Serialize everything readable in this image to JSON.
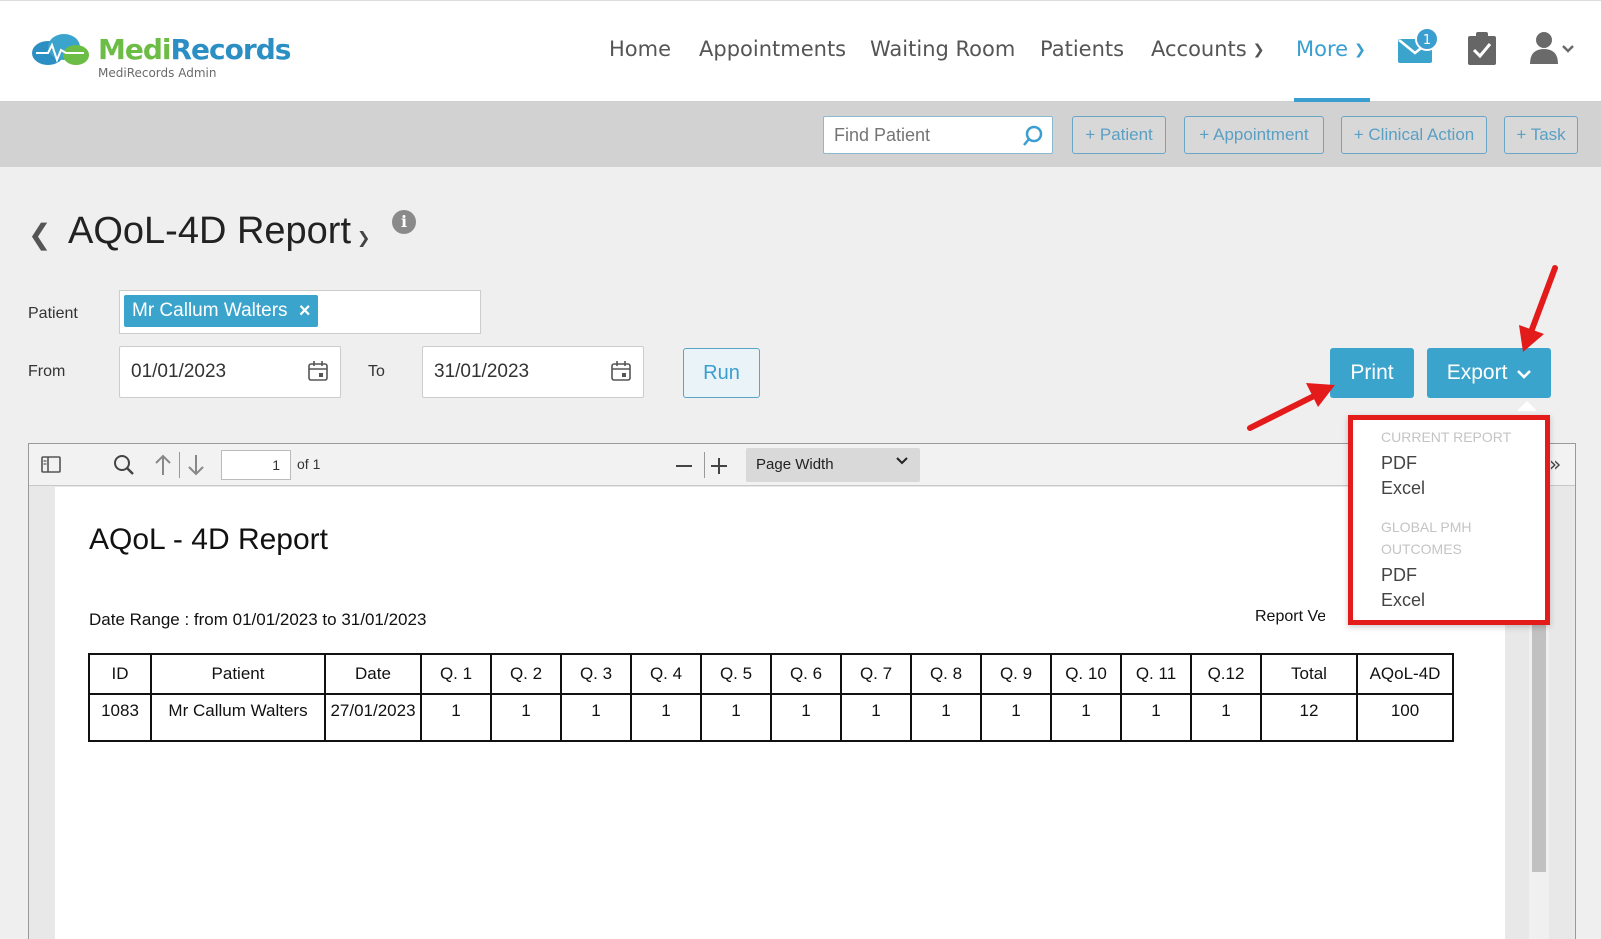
{
  "brand": {
    "name_part1": "Medi",
    "name_part2": "Records",
    "subtitle": "MediRecords Admin"
  },
  "nav": {
    "home": "Home",
    "appointments": "Appointments",
    "waiting_room": "Waiting Room",
    "patients": "Patients",
    "accounts": "Accounts",
    "more": "More",
    "messages_badge": "1"
  },
  "actionbar": {
    "find_placeholder": "Find Patient",
    "add_patient": "+ Patient",
    "add_appointment": "+ Appointment",
    "add_clinical_action": "+ Clinical Action",
    "add_task": "+ Task"
  },
  "page": {
    "title": "AQoL-4D Report",
    "info": "i"
  },
  "filters": {
    "patient_label": "Patient",
    "patient_value": "Mr Callum Walters",
    "from_label": "From",
    "from_value": "01/01/2023",
    "to_label": "To",
    "to_value": "31/01/2023",
    "run_label": "Run",
    "print_label": "Print",
    "export_label": "Export"
  },
  "export_menu": {
    "section1": "CURRENT REPORT",
    "section1_pdf": "PDF",
    "section1_excel": "Excel",
    "section2": "GLOBAL PMH OUTCOMES",
    "section2_pdf": "PDF",
    "section2_excel": "Excel"
  },
  "viewer": {
    "page_number": "1",
    "page_of": "of 1",
    "zoom": "Page Width"
  },
  "report": {
    "title": "AQoL - 4D Report",
    "date_range": "Date Range : from 01/01/2023 to 31/01/2023",
    "version_partial": "Report Ve",
    "columns": [
      "ID",
      "Patient",
      "Date",
      "Q. 1",
      "Q. 2",
      "Q. 3",
      "Q. 4",
      "Q. 5",
      "Q. 6",
      "Q. 7",
      "Q. 8",
      "Q. 9",
      "Q. 10",
      "Q. 11",
      "Q.12",
      "Total",
      "AQoL-4D"
    ],
    "rows": [
      [
        "1083",
        "Mr Callum Walters",
        "27/01/2023",
        "1",
        "1",
        "1",
        "1",
        "1",
        "1",
        "1",
        "1",
        "1",
        "1",
        "1",
        "1",
        "12",
        "100"
      ]
    ]
  },
  "colors": {
    "accent": "#3ba4cc",
    "brand_green": "#6cbd45",
    "brand_blue": "#2b8fc4",
    "highlight_red": "#e31b1b"
  }
}
